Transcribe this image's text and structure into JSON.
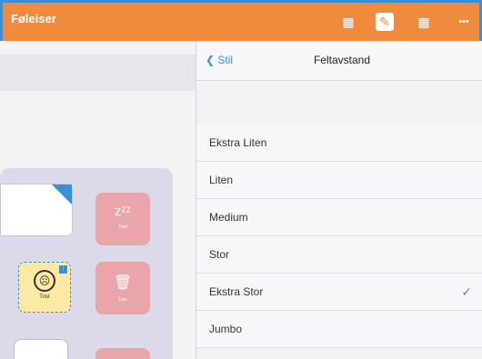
{
  "app": {
    "title": "Føleiser"
  },
  "toolbar": {
    "icons": [
      {
        "name": "grid-plus-icon",
        "glyph": "▦"
      },
      {
        "name": "brush-icon",
        "glyph": "✎"
      },
      {
        "name": "grid-icon",
        "glyph": "▦"
      },
      {
        "name": "more-icon",
        "glyph": "•••"
      }
    ]
  },
  "board": {
    "tiles": [
      {
        "name": "sleepy",
        "glyph": "zᶻᶻ",
        "label": "Trøtt"
      },
      {
        "name": "face",
        "glyph": "☹",
        "label": "Trist"
      },
      {
        "name": "trash",
        "glyph": "🗑",
        "label": "Tom"
      }
    ]
  },
  "panel": {
    "back_label": "Stil",
    "title": "Feltavstand",
    "options": [
      "Ekstra Liten",
      "Liten",
      "Medium",
      "Stor",
      "Ekstra Stor",
      "Jumbo"
    ],
    "selected": "Ekstra Stor"
  },
  "colors": {
    "accent": "#f08a3c",
    "blue": "#3a8fd8"
  }
}
